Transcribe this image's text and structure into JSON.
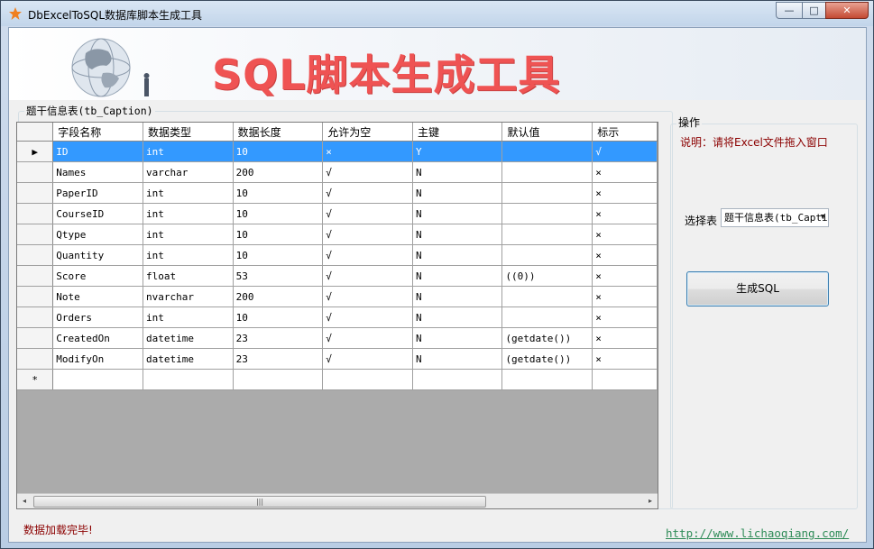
{
  "window": {
    "title": "DbExcelToSQL数据库脚本生成工具",
    "buttons": {
      "minimize": "—",
      "maximize": "□",
      "close": "✕"
    }
  },
  "banner": {
    "title": "SQL脚本生成工具"
  },
  "table_group": {
    "label": "题干信息表(tb_Caption)",
    "columns": [
      "字段名称",
      "数据类型",
      "数据长度",
      "允许为空",
      "主键",
      "默认值",
      "标示"
    ],
    "rows": [
      [
        "ID",
        "int",
        "10",
        "×",
        "Y",
        "",
        "√"
      ],
      [
        "Names",
        "varchar",
        "200",
        "√",
        "N",
        "",
        "×"
      ],
      [
        "PaperID",
        "int",
        "10",
        "√",
        "N",
        "",
        "×"
      ],
      [
        "CourseID",
        "int",
        "10",
        "√",
        "N",
        "",
        "×"
      ],
      [
        "Qtype",
        "int",
        "10",
        "√",
        "N",
        "",
        "×"
      ],
      [
        "Quantity",
        "int",
        "10",
        "√",
        "N",
        "",
        "×"
      ],
      [
        "Score",
        "float",
        "53",
        "√",
        "N",
        "((0))",
        "×"
      ],
      [
        "Note",
        "nvarchar",
        "200",
        "√",
        "N",
        "",
        "×"
      ],
      [
        "Orders",
        "int",
        "10",
        "√",
        "N",
        "",
        "×"
      ],
      [
        "CreatedOn",
        "datetime",
        "23",
        "√",
        "N",
        "(getdate())",
        "×"
      ],
      [
        "ModifyOn",
        "datetime",
        "23",
        "√",
        "N",
        "(getdate())",
        "×"
      ]
    ],
    "selected_row": 0,
    "new_row_marker": "*",
    "current_row_marker": "▶",
    "scrollbar": {
      "left_arrow": "◂",
      "right_arrow": "▸",
      "thumb_grip": "|||"
    }
  },
  "operations": {
    "label": "操作",
    "hint": "说明：请将Excel文件拖入窗口",
    "select_label": "选择表",
    "select_value": "题干信息表(tb_Caption)",
    "generate_button": "生成SQL"
  },
  "status_text": "数据加载完毕!",
  "link_text": "http://www.lichaoqiang.com/",
  "colors": {
    "banner_title": "#ef5353",
    "selection": "#3399ff",
    "hint": "#8b0000",
    "link": "#2e8b57"
  }
}
